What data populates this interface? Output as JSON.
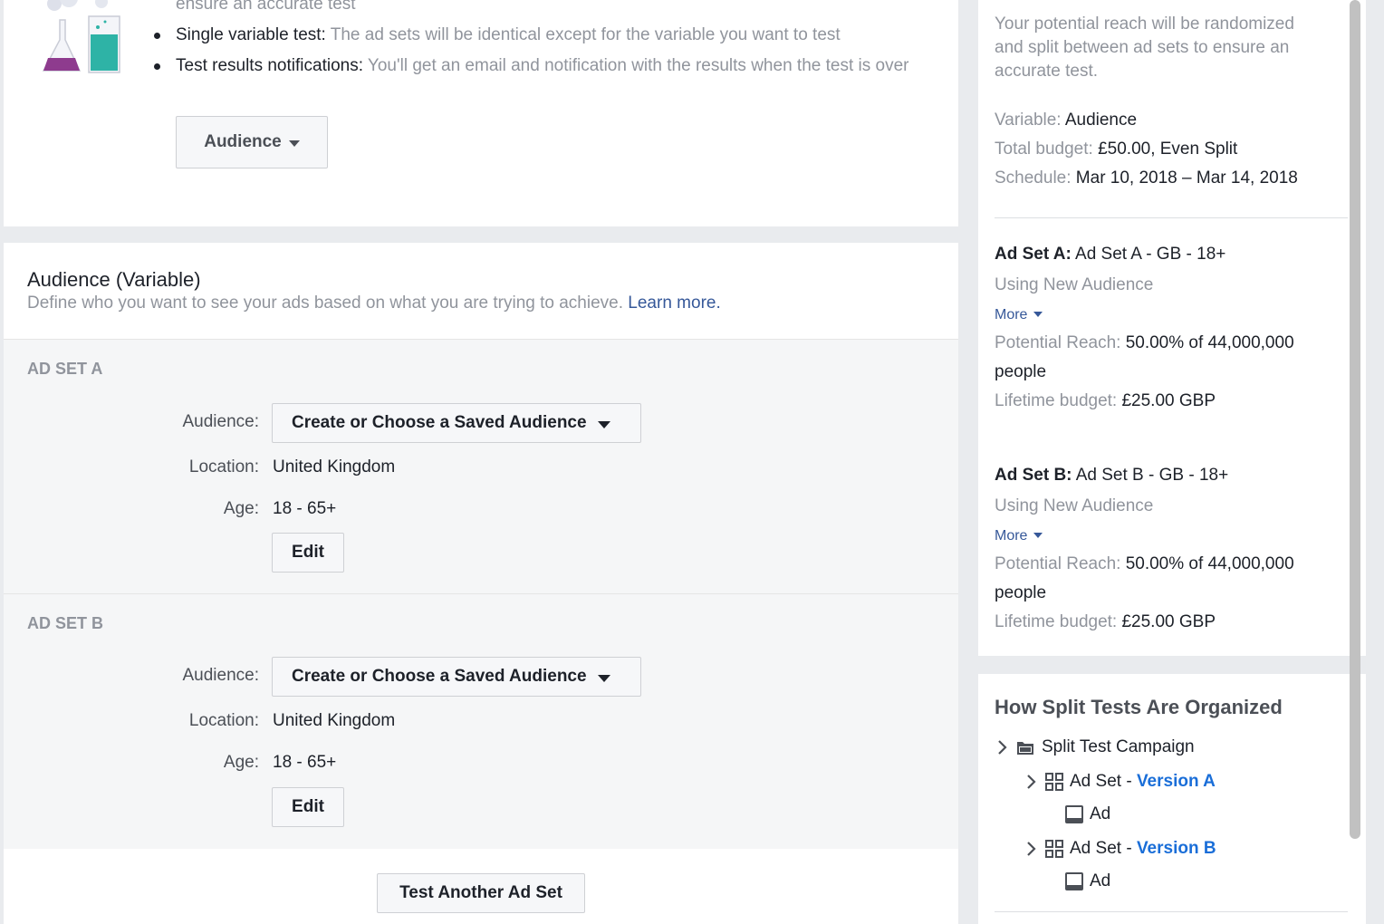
{
  "intro": {
    "clipped_line": "ensure an accurate test",
    "bullets": [
      {
        "label": "Single variable test:",
        "text": " The ad sets will be identical except for the variable you want to test"
      },
      {
        "label": "Test results notifications:",
        "text": " You'll get an email and notification with the results when the test is over"
      }
    ],
    "variable_button": "Audience"
  },
  "audience": {
    "title": "Audience (Variable)",
    "description": "Define who you want to see your ads based on what you are trying to achieve. ",
    "learn_more": "Learn more.",
    "ad_sets": [
      {
        "label": "AD SET A",
        "audience_label": "Audience:",
        "audience_select": "Create or Choose a Saved Audience",
        "location_label": "Location:",
        "location": "United Kingdom",
        "age_label": "Age:",
        "age": "18 - 65+",
        "edit": "Edit"
      },
      {
        "label": "AD SET B",
        "audience_label": "Audience:",
        "audience_select": "Create or Choose a Saved Audience",
        "location_label": "Location:",
        "location": "United Kingdom",
        "age_label": "Age:",
        "age": "18 - 65+",
        "edit": "Edit"
      }
    ],
    "test_another": "Test Another Ad Set"
  },
  "summary": {
    "reach_note_1": "Your potential reach will be randomized",
    "reach_note_2": "and split between ad sets to ensure an",
    "reach_note_3": "accurate test.",
    "variable_label": "Variable:",
    "variable_value": " Audience",
    "budget_label": "Total budget:",
    "budget_value": " £50.00, Even Split",
    "schedule_label": "Schedule:",
    "schedule_value": " Mar 10, 2018 – Mar 14, 2018",
    "ad_sets": [
      {
        "name_label": "Ad Set A:",
        "name_value": " Ad Set A - GB - 18+",
        "audience_note": "Using New Audience",
        "more": "More",
        "reach_label": "Potential Reach:",
        "reach_value": " 50.00% of 44,000,000",
        "reach_value_2": "people",
        "budget_label": "Lifetime budget:",
        "budget_value": " £25.00 GBP"
      },
      {
        "name_label": "Ad Set B:",
        "name_value": " Ad Set B - GB - 18+",
        "audience_note": "Using New Audience",
        "more": "More",
        "reach_label": "Potential Reach:",
        "reach_value": " 50.00% of 44,000,000",
        "reach_value_2": "people",
        "budget_label": "Lifetime budget:",
        "budget_value": " £25.00 GBP"
      }
    ]
  },
  "organization": {
    "title": "How Split Tests Are Organized",
    "campaign": "Split Test Campaign",
    "ad_set_prefix": "Ad Set - ",
    "version_a": "Version A",
    "version_b": "Version B",
    "ad": "Ad"
  },
  "colors": {
    "link": "#365899",
    "version": "#1a6ed8",
    "flask_purple": "#8e3b8e",
    "flask_teal": "#2eb3a6"
  }
}
